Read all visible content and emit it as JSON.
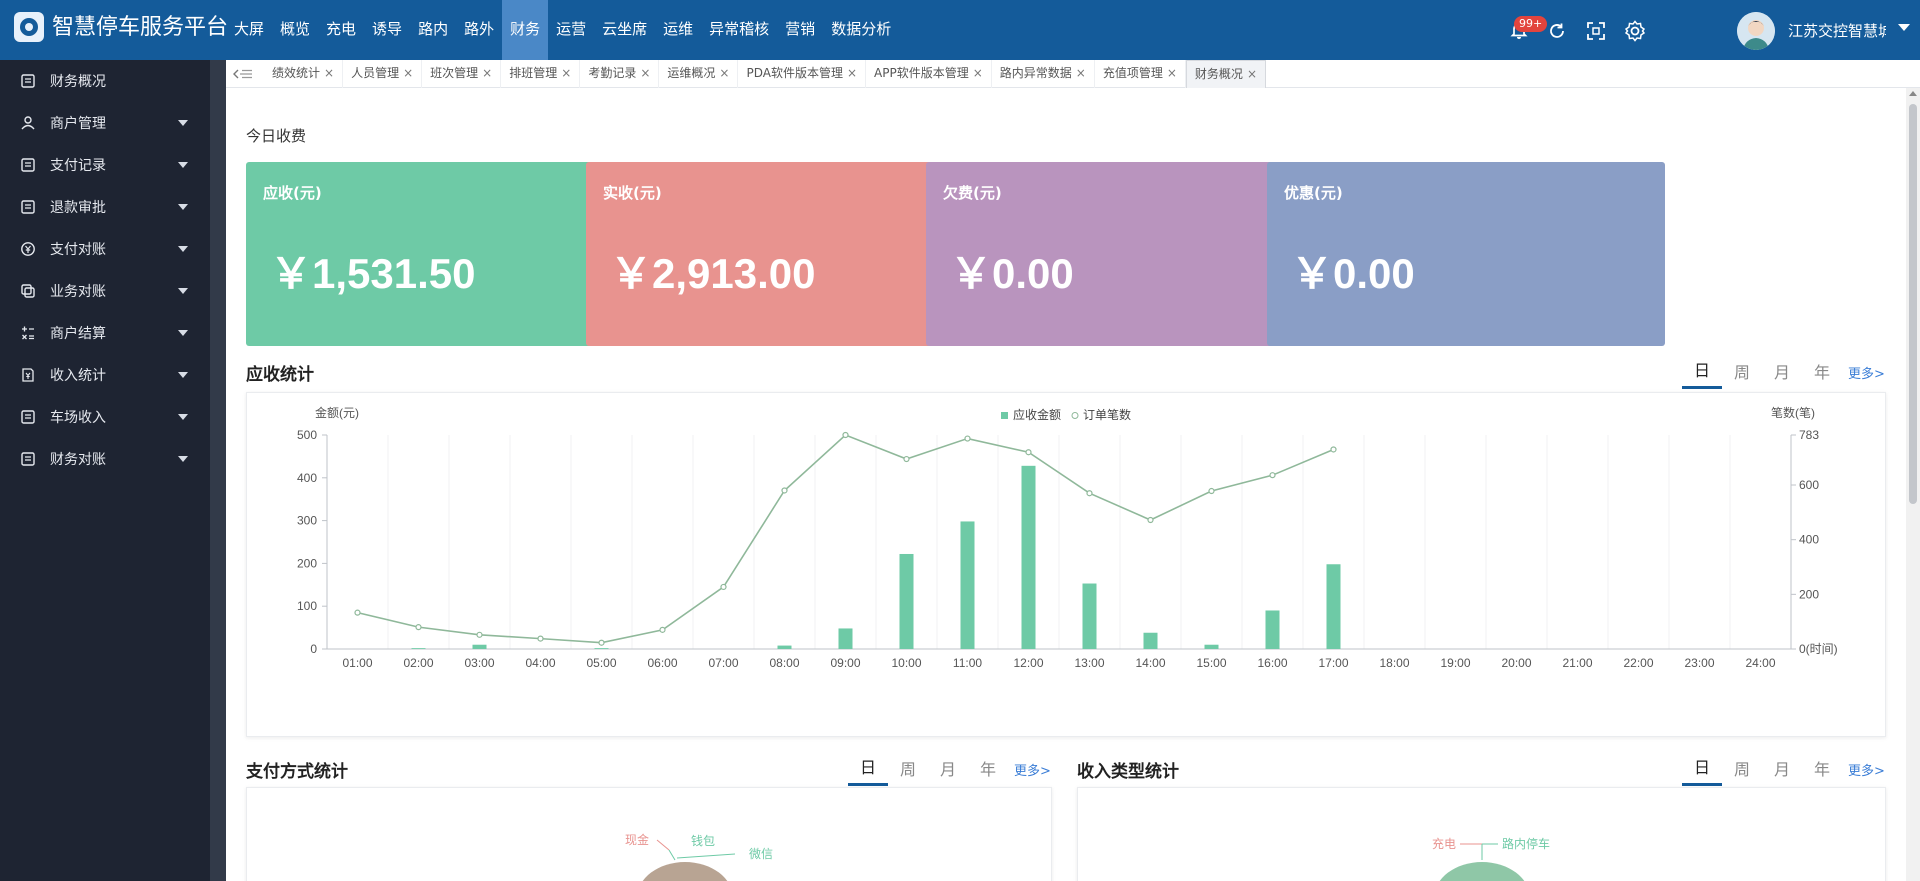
{
  "app": {
    "title": "智慧停车服务平台",
    "logo_icon": "platform-logo-icon"
  },
  "nav": [
    "大屏",
    "概览",
    "充电",
    "诱导",
    "路内",
    "路外",
    "财务",
    "运营",
    "云坐席",
    "运维",
    "异常稽核",
    "营销",
    "数据分析"
  ],
  "nav_active": "财务",
  "header": {
    "badge": "99+",
    "username": "江苏交控智慧城市",
    "accent": "#145b9a",
    "badge_color": "#e2443d"
  },
  "sidebar": {
    "items": [
      {
        "label": "财务概况",
        "icon": "document-icon",
        "caret": false
      },
      {
        "label": "商户管理",
        "icon": "merchant-icon",
        "caret": true
      },
      {
        "label": "支付记录",
        "icon": "document-icon",
        "caret": true
      },
      {
        "label": "退款审批",
        "icon": "document-icon",
        "caret": true
      },
      {
        "label": "支付对账",
        "icon": "yuan-circle-icon",
        "caret": true
      },
      {
        "label": "业务对账",
        "icon": "copy-icon",
        "caret": true
      },
      {
        "label": "商户结算",
        "icon": "calculator-icon",
        "caret": true
      },
      {
        "label": "收入统计",
        "icon": "yuan-document-icon",
        "caret": true
      },
      {
        "label": "车场收入",
        "icon": "document-icon",
        "caret": true
      },
      {
        "label": "财务对账",
        "icon": "document-icon",
        "caret": true
      }
    ]
  },
  "tabs": [
    {
      "label": "绩效统计",
      "active": false
    },
    {
      "label": "人员管理",
      "active": false
    },
    {
      "label": "班次管理",
      "active": false
    },
    {
      "label": "排班管理",
      "active": false
    },
    {
      "label": "考勤记录",
      "active": false
    },
    {
      "label": "运维概况",
      "active": false
    },
    {
      "label": "PDA软件版本管理",
      "active": false
    },
    {
      "label": "APP软件版本管理",
      "active": false
    },
    {
      "label": "路内异常数据",
      "active": false
    },
    {
      "label": "充值项管理",
      "active": false
    },
    {
      "label": "财务概况",
      "active": true
    }
  ],
  "tab_close": "×",
  "today": {
    "title": "今日收费",
    "cards": [
      {
        "label": "应收(元)",
        "value": "￥1,531.50",
        "color": "#6ecaa6",
        "arrow": ""
      },
      {
        "label": "实收(元)",
        "value": "￥2,913.00",
        "color": "#e8938f",
        "arrow": ">"
      },
      {
        "label": "欠费(元)",
        "value": "￥0.00",
        "color": "#b994be",
        "arrow": ">"
      },
      {
        "label": "优惠(元)",
        "value": "￥0.00",
        "color": "#8a9ec6",
        "arrow": ""
      }
    ]
  },
  "receivable": {
    "title": "应收统计",
    "periods": [
      "日",
      "周",
      "月",
      "年"
    ],
    "more": "更多>"
  },
  "payment": {
    "title": "支付方式统计",
    "periods": [
      "日",
      "周",
      "月",
      "年"
    ],
    "more": "更多>"
  },
  "income": {
    "title": "收入类型统计",
    "periods": [
      "日",
      "周",
      "月",
      "年"
    ],
    "more": "更多>"
  },
  "chart_data": {
    "type": "bar",
    "categories": [
      "01:00",
      "02:00",
      "03:00",
      "04:00",
      "05:00",
      "06:00",
      "07:00",
      "08:00",
      "09:00",
      "10:00",
      "11:00",
      "12:00",
      "13:00",
      "14:00",
      "15:00",
      "16:00",
      "17:00",
      "18:00",
      "19:00",
      "20:00",
      "21:00",
      "22:00",
      "23:00",
      "24:00"
    ],
    "series": [
      {
        "name": "应收金额",
        "type": "bar",
        "axis": "left",
        "color": "#6ecaa6",
        "values": [
          0,
          2,
          10,
          0,
          2,
          0,
          0,
          8,
          48,
          222,
          298,
          428,
          153,
          38,
          10,
          90,
          198,
          null,
          null,
          null,
          null,
          null,
          null,
          null
        ]
      },
      {
        "name": "订单笔数",
        "type": "line",
        "axis": "right",
        "color": "#8fb89a",
        "values": [
          133,
          80,
          52,
          38,
          23,
          70,
          227,
          580,
          783,
          695,
          770,
          720,
          570,
          472,
          578,
          636,
          730,
          null,
          null,
          null,
          null,
          null,
          null,
          null
        ]
      }
    ],
    "ylabel": "金额(元)",
    "ylabel_right": "笔数(笔)",
    "ylim": [
      0,
      500
    ],
    "yticks": [
      0,
      100,
      200,
      300,
      400,
      500
    ],
    "ylim_right": [
      0,
      783
    ],
    "yticks_right": [
      "0(时间)",
      "200",
      "400",
      "600",
      "783"
    ],
    "yticks_right_values": [
      0,
      200,
      400,
      600,
      783
    ],
    "legend_position": "top-center",
    "grid": true
  },
  "pie_labels": {
    "payment": [
      "现金",
      "钱包",
      "微信"
    ],
    "income": [
      "充电",
      "路内停车"
    ]
  }
}
